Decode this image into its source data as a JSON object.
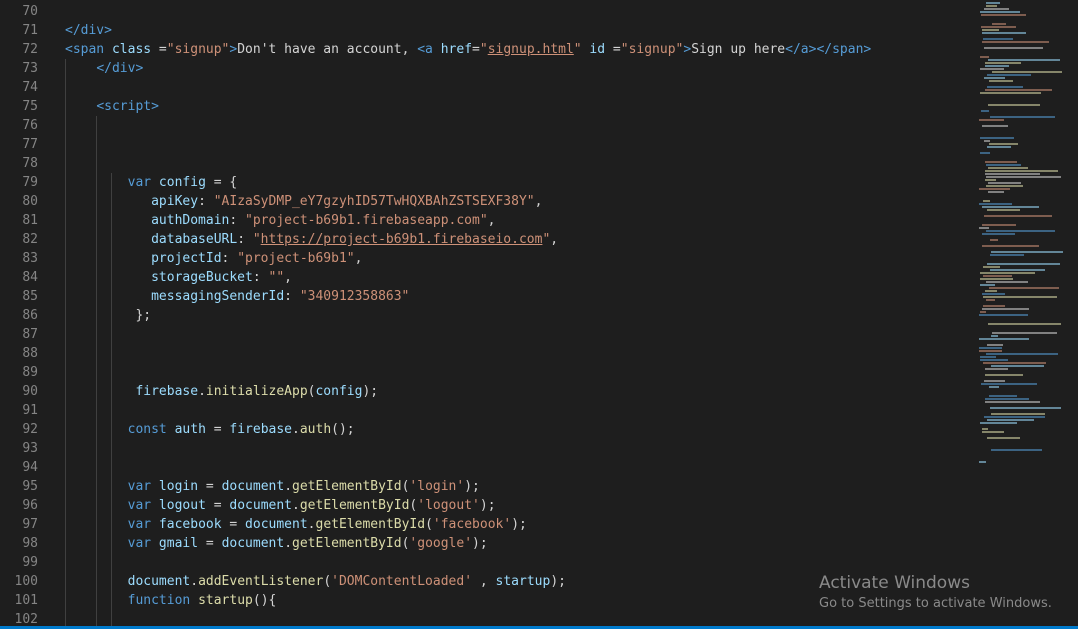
{
  "colors": {
    "background": "#1e1e1e",
    "line_number": "#858585",
    "tag": "#569cd6",
    "attribute": "#9cdcfe",
    "string": "#ce9178",
    "text": "#d4d4d4",
    "function": "#dcdcaa",
    "keyword": "#569cd6",
    "status_bar": "#007acc"
  },
  "lines": [
    {
      "n": "70",
      "tokens": []
    },
    {
      "n": "71",
      "tokens": [
        [
          "</div>",
          "tag"
        ]
      ]
    },
    {
      "n": "72",
      "tokens": [
        [
          "<span ",
          "tag"
        ],
        [
          "class",
          "attribute"
        ],
        [
          " =",
          "text"
        ],
        [
          "\"signup\"",
          "string"
        ],
        [
          ">",
          "tag"
        ],
        [
          "Don't have an account, ",
          "text"
        ],
        [
          "<a ",
          "tag"
        ],
        [
          "href",
          "attribute"
        ],
        [
          "=",
          "text"
        ],
        [
          "\"",
          "string"
        ],
        [
          "signup.html",
          "string-link"
        ],
        [
          "\"",
          "string"
        ],
        [
          " id",
          "attribute"
        ],
        [
          " =",
          "text"
        ],
        [
          "\"signup\"",
          "string"
        ],
        [
          ">",
          "tag"
        ],
        [
          "Sign up here",
          "text"
        ],
        [
          "</a>",
          "tag"
        ],
        [
          "</span>",
          "tag"
        ]
      ]
    },
    {
      "n": "73",
      "tokens": [
        [
          "    ",
          "text"
        ],
        [
          "</div>",
          "tag"
        ]
      ]
    },
    {
      "n": "74",
      "tokens": []
    },
    {
      "n": "75",
      "tokens": [
        [
          "    ",
          "text"
        ],
        [
          "<script>",
          "tag"
        ]
      ]
    },
    {
      "n": "76",
      "tokens": []
    },
    {
      "n": "77",
      "tokens": []
    },
    {
      "n": "78",
      "tokens": []
    },
    {
      "n": "79",
      "tokens": [
        [
          "        ",
          "text"
        ],
        [
          "var",
          "keyword"
        ],
        [
          " config",
          "attribute"
        ],
        [
          " = {",
          "text"
        ]
      ]
    },
    {
      "n": "80",
      "tokens": [
        [
          "           ",
          "text"
        ],
        [
          "apiKey",
          "attribute"
        ],
        [
          ": ",
          "text"
        ],
        [
          "\"AIzaSyDMP_eY7gzyhID57TwHQXBAhZSTSEXF38Y\"",
          "string"
        ],
        [
          ",",
          "text"
        ]
      ]
    },
    {
      "n": "81",
      "tokens": [
        [
          "           ",
          "text"
        ],
        [
          "authDomain",
          "attribute"
        ],
        [
          ": ",
          "text"
        ],
        [
          "\"project-b69b1.firebaseapp.com\"",
          "string"
        ],
        [
          ",",
          "text"
        ]
      ]
    },
    {
      "n": "82",
      "tokens": [
        [
          "           ",
          "text"
        ],
        [
          "databaseURL",
          "attribute"
        ],
        [
          ": ",
          "text"
        ],
        [
          "\"",
          "string"
        ],
        [
          "https://project-b69b1.firebaseio.com",
          "string-link"
        ],
        [
          "\"",
          "string"
        ],
        [
          ",",
          "text"
        ]
      ]
    },
    {
      "n": "83",
      "tokens": [
        [
          "           ",
          "text"
        ],
        [
          "projectId",
          "attribute"
        ],
        [
          ": ",
          "text"
        ],
        [
          "\"project-b69b1\"",
          "string"
        ],
        [
          ",",
          "text"
        ]
      ]
    },
    {
      "n": "84",
      "tokens": [
        [
          "           ",
          "text"
        ],
        [
          "storageBucket",
          "attribute"
        ],
        [
          ": ",
          "text"
        ],
        [
          "\"\"",
          "string"
        ],
        [
          ",",
          "text"
        ]
      ]
    },
    {
      "n": "85",
      "tokens": [
        [
          "           ",
          "text"
        ],
        [
          "messagingSenderId",
          "attribute"
        ],
        [
          ": ",
          "text"
        ],
        [
          "\"340912358863\"",
          "string"
        ]
      ]
    },
    {
      "n": "86",
      "tokens": [
        [
          "         };",
          "text"
        ]
      ]
    },
    {
      "n": "87",
      "tokens": []
    },
    {
      "n": "88",
      "tokens": []
    },
    {
      "n": "89",
      "tokens": []
    },
    {
      "n": "90",
      "tokens": [
        [
          "         ",
          "text"
        ],
        [
          "firebase",
          "attribute"
        ],
        [
          ".",
          "text"
        ],
        [
          "initializeApp",
          "function"
        ],
        [
          "(",
          "text"
        ],
        [
          "config",
          "attribute"
        ],
        [
          ");",
          "text"
        ]
      ]
    },
    {
      "n": "91",
      "tokens": []
    },
    {
      "n": "92",
      "tokens": [
        [
          "        ",
          "text"
        ],
        [
          "const",
          "keyword"
        ],
        [
          " auth",
          "attribute"
        ],
        [
          " = ",
          "text"
        ],
        [
          "firebase",
          "attribute"
        ],
        [
          ".",
          "text"
        ],
        [
          "auth",
          "function"
        ],
        [
          "();",
          "text"
        ]
      ]
    },
    {
      "n": "93",
      "tokens": []
    },
    {
      "n": "94",
      "tokens": []
    },
    {
      "n": "95",
      "tokens": [
        [
          "        ",
          "text"
        ],
        [
          "var",
          "keyword"
        ],
        [
          " login",
          "attribute"
        ],
        [
          " = ",
          "text"
        ],
        [
          "document",
          "attribute"
        ],
        [
          ".",
          "text"
        ],
        [
          "getElementById",
          "function"
        ],
        [
          "(",
          "text"
        ],
        [
          "'login'",
          "string"
        ],
        [
          ");",
          "text"
        ]
      ]
    },
    {
      "n": "96",
      "tokens": [
        [
          "        ",
          "text"
        ],
        [
          "var",
          "keyword"
        ],
        [
          " logout",
          "attribute"
        ],
        [
          " = ",
          "text"
        ],
        [
          "document",
          "attribute"
        ],
        [
          ".",
          "text"
        ],
        [
          "getElementById",
          "function"
        ],
        [
          "(",
          "text"
        ],
        [
          "'logout'",
          "string"
        ],
        [
          ");",
          "text"
        ]
      ]
    },
    {
      "n": "97",
      "tokens": [
        [
          "        ",
          "text"
        ],
        [
          "var",
          "keyword"
        ],
        [
          " facebook",
          "attribute"
        ],
        [
          " = ",
          "text"
        ],
        [
          "document",
          "attribute"
        ],
        [
          ".",
          "text"
        ],
        [
          "getElementById",
          "function"
        ],
        [
          "(",
          "text"
        ],
        [
          "'facebook'",
          "string"
        ],
        [
          ");",
          "text"
        ]
      ]
    },
    {
      "n": "98",
      "tokens": [
        [
          "        ",
          "text"
        ],
        [
          "var",
          "keyword"
        ],
        [
          " gmail",
          "attribute"
        ],
        [
          " = ",
          "text"
        ],
        [
          "document",
          "attribute"
        ],
        [
          ".",
          "text"
        ],
        [
          "getElementById",
          "function"
        ],
        [
          "(",
          "text"
        ],
        [
          "'google'",
          "string"
        ],
        [
          ");",
          "text"
        ]
      ]
    },
    {
      "n": "99",
      "tokens": []
    },
    {
      "n": "100",
      "tokens": [
        [
          "        ",
          "text"
        ],
        [
          "document",
          "attribute"
        ],
        [
          ".",
          "text"
        ],
        [
          "addEventListener",
          "function"
        ],
        [
          "(",
          "text"
        ],
        [
          "'DOMContentLoaded'",
          "string"
        ],
        [
          " , ",
          "text"
        ],
        [
          "startup",
          "attribute"
        ],
        [
          ");",
          "text"
        ]
      ]
    },
    {
      "n": "101",
      "tokens": [
        [
          "        ",
          "text"
        ],
        [
          "function",
          "keyword"
        ],
        [
          " ",
          "text"
        ],
        [
          "startup",
          "function"
        ],
        [
          "(){",
          "text"
        ]
      ]
    },
    {
      "n": "102",
      "tokens": []
    }
  ],
  "watermark": {
    "title": "Activate Windows",
    "subtitle": "Go to Settings to activate Windows."
  }
}
